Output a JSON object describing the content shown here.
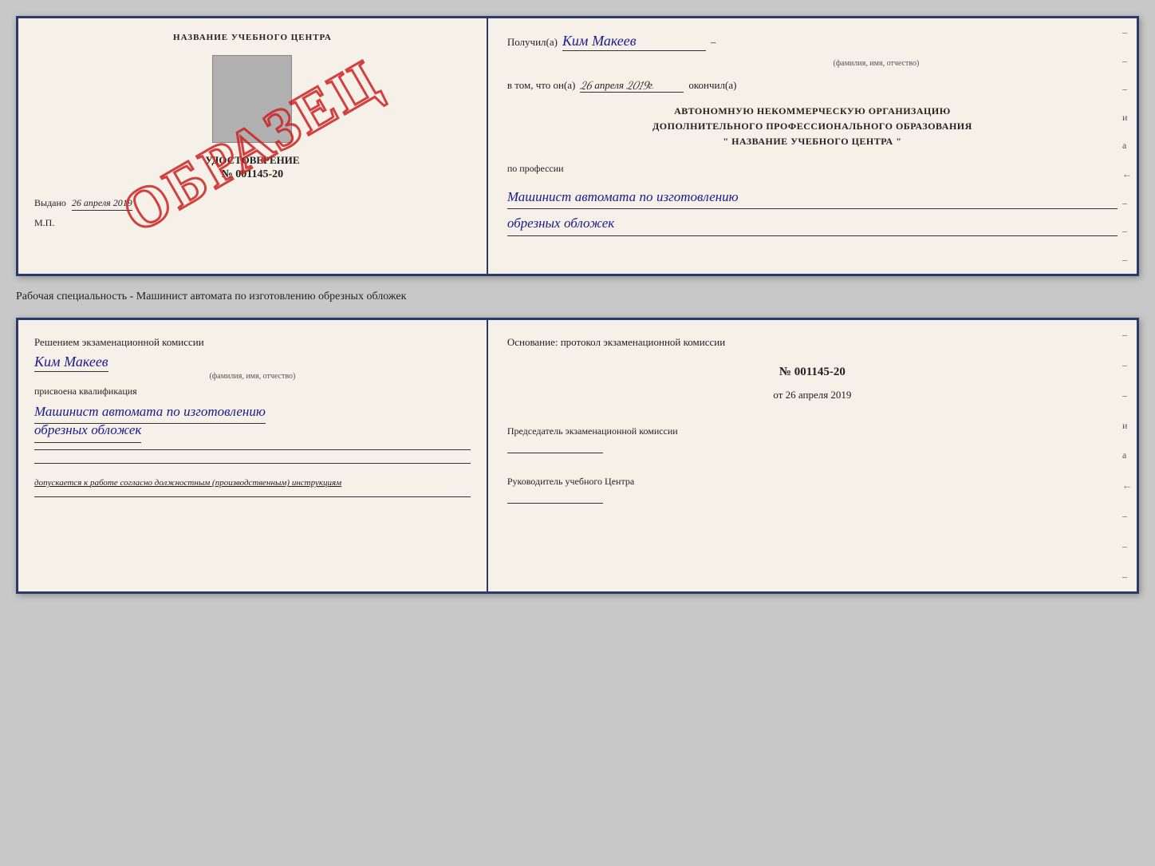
{
  "topDoc": {
    "left": {
      "centerTitle": "НАЗВАНИЕ УЧЕБНОГО ЦЕНТРА",
      "watermark": "ОБРАЗЕЦ",
      "certTitle": "УДОСТОВЕРЕНИЕ",
      "certNumber": "№ 001145-20",
      "issuedLabel": "Выдано",
      "issuedDate": "26 апреля 2019",
      "mpLabel": "М.П."
    },
    "right": {
      "recipientLabel": "Получил(а)",
      "recipientName": "Ким Макеев",
      "recipientSubLabel": "(фамилия, имя, отчество)",
      "dateLabel": "в том, что он(а)",
      "dateValue": "26 апреля 2019г.",
      "dateEndLabel": "окончил(а)",
      "orgLine1": "АВТОНОМНУЮ НЕКОММЕРЧЕСКУЮ ОРГАНИЗАЦИЮ",
      "orgLine2": "ДОПОЛНИТЕЛЬНОГО ПРОФЕССИОНАЛЬНОГО ОБРАЗОВАНИЯ",
      "orgLine3": "\" НАЗВАНИЕ УЧЕБНОГО ЦЕНТРА \"",
      "professionLabel": "по профессии",
      "professionLine1": "Машинист автомата по изготовлению",
      "professionLine2": "обрезных обложек",
      "dashLabels": [
        "–",
        "–",
        "–",
        "–",
        "и",
        "а",
        "←",
        "–",
        "–",
        "–",
        "–"
      ]
    }
  },
  "infoBar": {
    "text": "Рабочая специальность - Машинист автомата по изготовлению обрезных обложек"
  },
  "bottomDoc": {
    "left": {
      "decisionText": "Решением экзаменационной комиссии",
      "name": "Ким Макеев",
      "nameSubLabel": "(фамилия, имя, отчество)",
      "qualificationLabel": "присвоена квалификация",
      "qualificationLine1": "Машинист автомата по изготовлению",
      "qualificationLine2": "обрезных обложек",
      "allowedLabel": "допускается к",
      "allowedText": "работе согласно должностным (производственным) инструкциям"
    },
    "right": {
      "basisLabel": "Основание: протокол экзаменационной комиссии",
      "protocolNum": "№ 001145-20",
      "protocolDatePrefix": "от",
      "protocolDate": "26 апреля 2019",
      "chairmanLabel": "Председатель экзаменационной комиссии",
      "headLabel": "Руководитель учебного Центра",
      "dashLabels": [
        "–",
        "–",
        "–",
        "и",
        "а",
        "←",
        "–",
        "–",
        "–",
        "–"
      ]
    }
  }
}
